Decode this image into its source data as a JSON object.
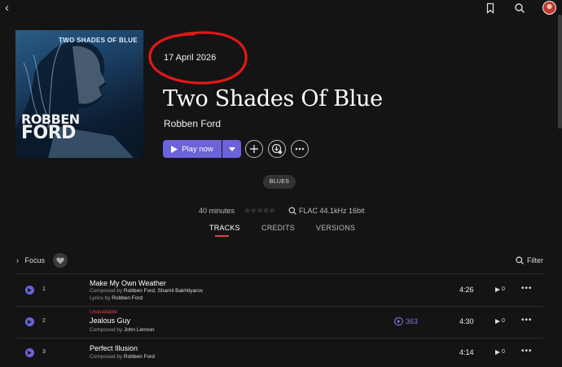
{
  "topbar": {
    "back_icon": "chevron-left-icon",
    "icons": [
      "bookmark-icon",
      "search-icon"
    ]
  },
  "album": {
    "cover_title": "TWO SHADES OF BLUE",
    "cover_artist_line1": "ROBBEN",
    "cover_artist_line2": "FORD",
    "release_date": "17 April 2026",
    "title": "Two Shades Of Blue",
    "artist": "Robben Ford"
  },
  "actions": {
    "play_label": "Play now"
  },
  "genre": "BLUES",
  "meta": {
    "duration": "40 minutes",
    "rating_stars": "☆☆☆☆☆",
    "quality": "FLAC 44.1kHz 16bit"
  },
  "tabs": [
    "TRACKS",
    "CREDITS",
    "VERSIONS"
  ],
  "toolbar": {
    "focus_label": "Focus",
    "filter_label": "Filter"
  },
  "tracks": [
    {
      "number": "1",
      "title": "Make My Own Weather",
      "composed_prefix": "Composed by ",
      "composed_by": "Robben Ford, Shamil Bakhtiyarov",
      "lyrics_prefix": "Lyrics by ",
      "lyrics_by": "Robben Ford",
      "duration": "4:26",
      "plays": "0"
    },
    {
      "number": "2",
      "status": "Unavailable",
      "title": "Jealous Guy",
      "composed_prefix": "Composed by ",
      "composed_by": "John Lennon",
      "stat": "363",
      "duration": "4:30",
      "plays": "0"
    },
    {
      "number": "3",
      "title": "Perfect Illusion",
      "composed_prefix": "Composed by ",
      "composed_by": "Robben Ford",
      "duration": "4:14",
      "plays": "0"
    }
  ],
  "colors": {
    "accent": "#6b63d8",
    "highlight_red": "#e0424b",
    "annotation_red": "#e01818",
    "background": "#141414"
  }
}
